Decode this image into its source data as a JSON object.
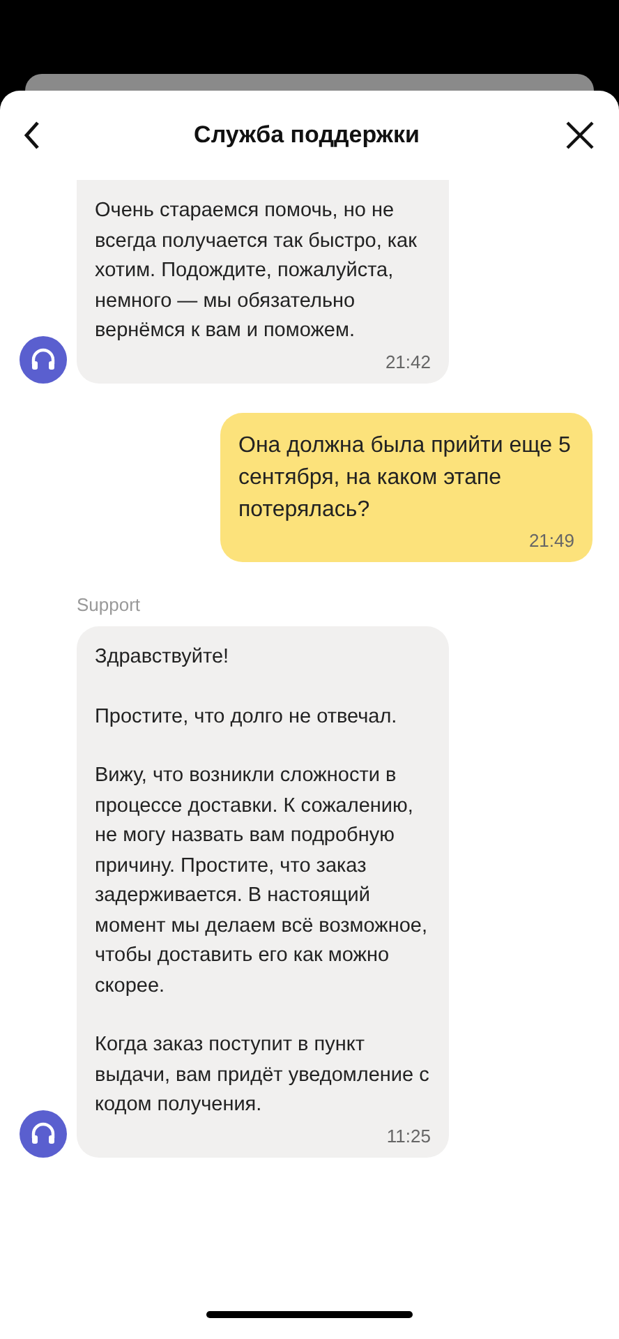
{
  "header": {
    "title": "Служба поддержки"
  },
  "messages": [
    {
      "kind": "incoming",
      "cut_top": true,
      "paragraphs": [
        "Очень стараемся помочь, но не всегда получается так быстро, как хотим. Подождите, пожалуйста, немного — мы обязательно вернёмся к вам и поможем."
      ],
      "time": "21:42"
    },
    {
      "kind": "outgoing",
      "paragraphs": [
        "Она должна была прийти еще 5 сентября, на каком этапе потерялась?"
      ],
      "time": "21:49"
    },
    {
      "kind": "incoming",
      "sender": "Support",
      "paragraphs": [
        "Здравствуйте!",
        "Простите, что долго не отвечал.",
        "Вижу, что возникли сложности в процессе доставки. К сожалению, не могу назвать вам подробную причину. Простите, что заказ задерживается. В настоящий момент мы делаем всё возможное, чтобы доставить его как можно скорее.",
        "Когда заказ поступит в пункт выдачи, вам придёт уведомление с кодом получения."
      ],
      "time": "11:25"
    }
  ]
}
